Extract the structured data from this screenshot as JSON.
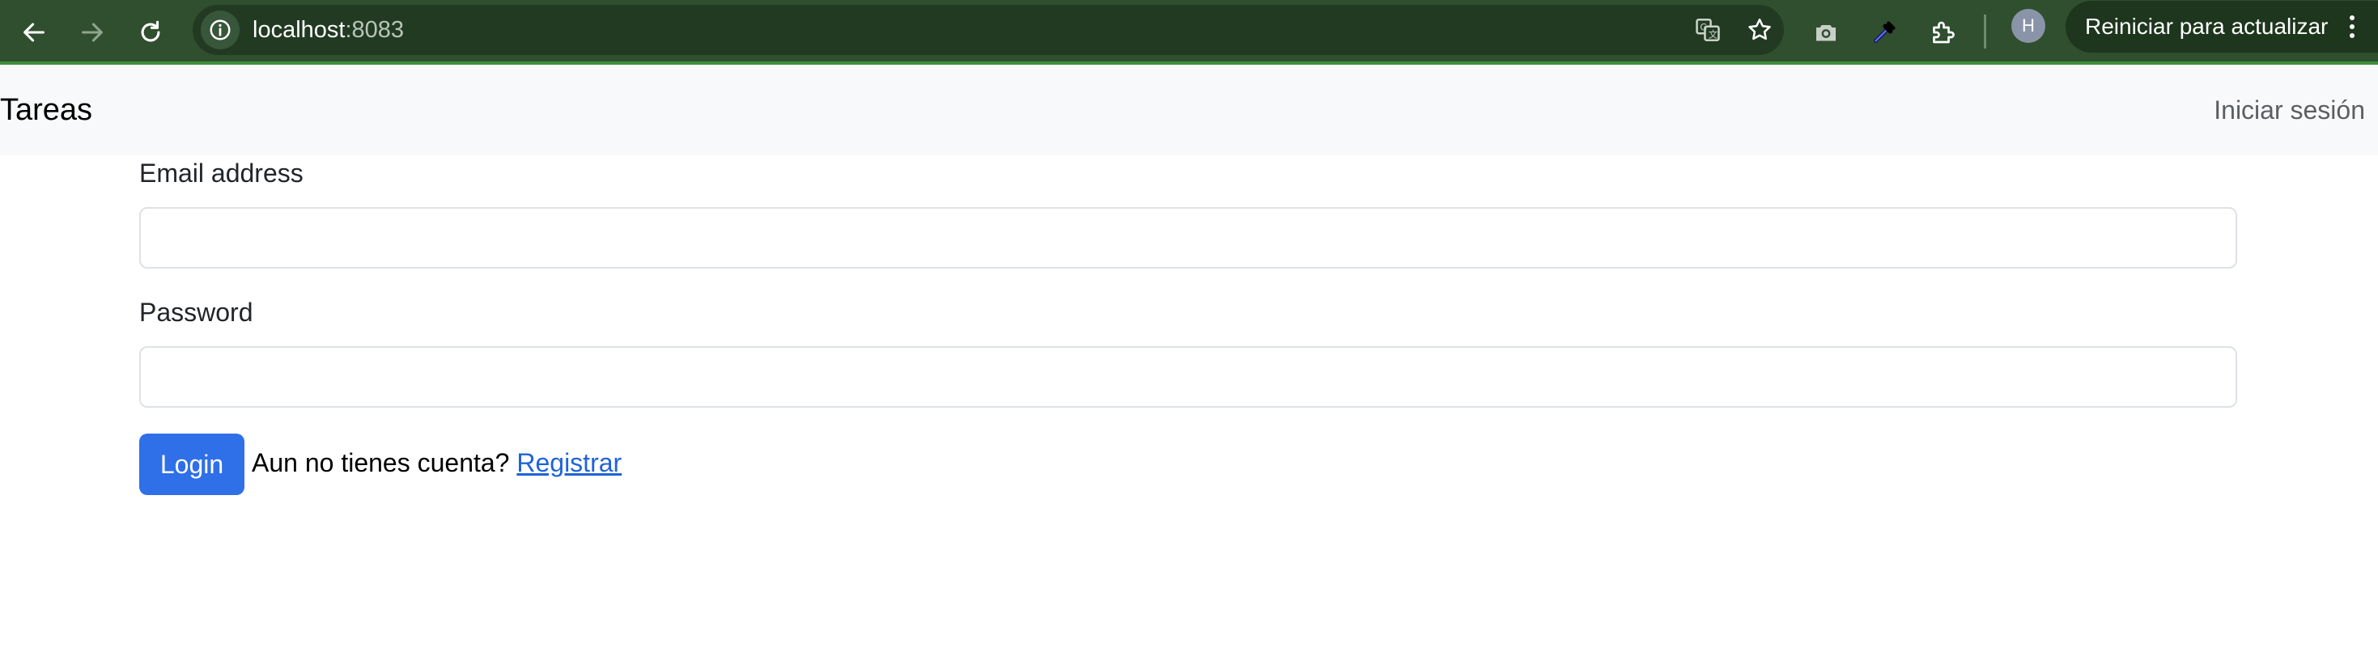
{
  "browser": {
    "url_host": "localhost",
    "url_port": ":8083",
    "update_button_label": "Reiniciar para actualizar",
    "profile_initial": "H",
    "icons": {
      "back": "back-arrow-icon",
      "forward": "forward-arrow-icon",
      "reload": "reload-icon",
      "site_info": "info-icon",
      "translate": "translate-icon",
      "bookmark": "star-icon",
      "camera": "camera-icon",
      "eyedropper": "eyedropper-icon",
      "extensions": "puzzle-icon",
      "menu": "kebab-menu-icon"
    },
    "toolbar_color": "#2f4f2e"
  },
  "navbar": {
    "brand": "Tareas",
    "login_link": "Iniciar sesión"
  },
  "form": {
    "email_label": "Email address",
    "email_value": "",
    "password_label": "Password",
    "password_value": "",
    "login_button": "Login",
    "register_prompt": "Aun no tienes cuenta?",
    "register_link": "Registrar"
  },
  "colors": {
    "primary": "#2f6fe8",
    "link": "#1f63d8",
    "navbar_bg": "#f8f9fa"
  }
}
